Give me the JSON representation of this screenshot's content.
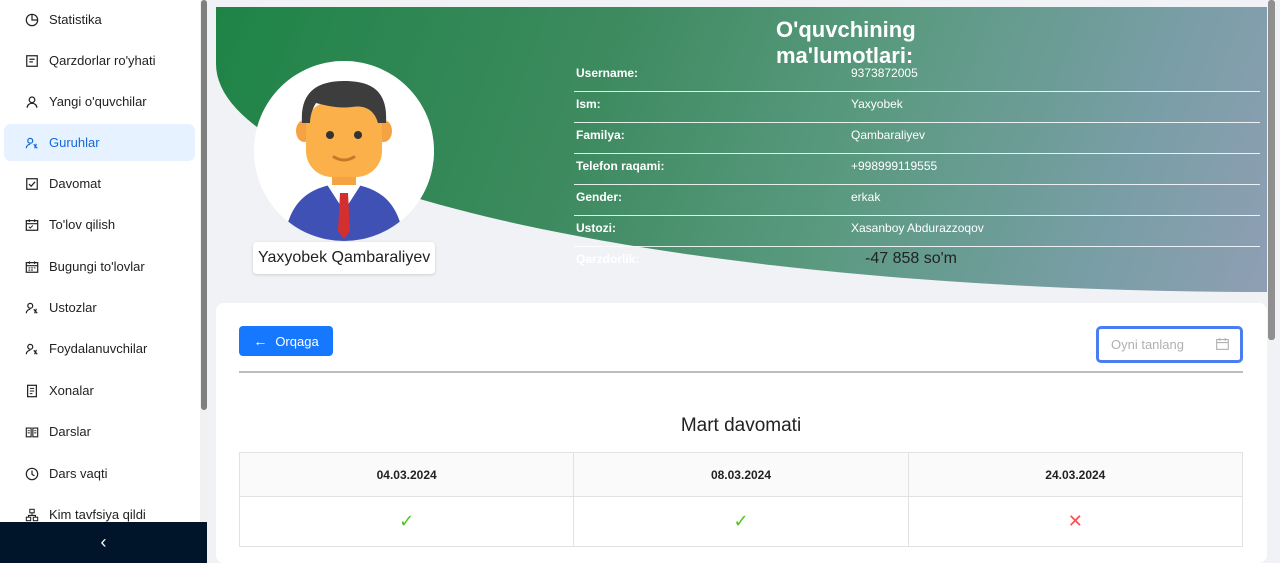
{
  "sidebar": {
    "items": [
      {
        "label": "Statistika",
        "icon": "pie-chart-icon"
      },
      {
        "label": "Qarzdorlar ro'yhati",
        "icon": "account-book-icon"
      },
      {
        "label": "Yangi o'quvchilar",
        "icon": "user-icon"
      },
      {
        "label": "Guruhlar",
        "icon": "team-icon",
        "active": true
      },
      {
        "label": "Davomat",
        "icon": "check-square-icon"
      },
      {
        "label": "To'lov qilish",
        "icon": "schedule-icon"
      },
      {
        "label": "Bugungi to'lovlar",
        "icon": "calendar-icon"
      },
      {
        "label": "Ustozlar",
        "icon": "team-icon"
      },
      {
        "label": "Foydalanuvchilar",
        "icon": "team-icon"
      },
      {
        "label": "Xonalar",
        "icon": "file-icon"
      },
      {
        "label": "Darslar",
        "icon": "read-icon"
      },
      {
        "label": "Dars vaqti",
        "icon": "clock-icon"
      },
      {
        "label": "Kim tavfsiya qildi",
        "icon": "cluster-icon"
      }
    ],
    "collapse_glyph": "‹"
  },
  "profile": {
    "title": "O'quvchining ma'lumotlari:",
    "name_tag": "Yaxyobek Qambaraliyev",
    "fields": [
      {
        "label": "Username:",
        "value": "9373872005"
      },
      {
        "label": "Ism:",
        "value": "Yaxyobek"
      },
      {
        "label": "Familya:",
        "value": "Qambaraliyev"
      },
      {
        "label": "Telefon raqami:",
        "value": "+998999119555"
      },
      {
        "label": "Gender:",
        "value": "erkak"
      },
      {
        "label": "Ustozi:",
        "value": "Xasanboy Abdurazzoqov"
      },
      {
        "label": "Qarzdorlik:",
        "value": "-47 858 so'm"
      }
    ]
  },
  "attendance": {
    "back_label": "Orqaga",
    "month_placeholder": "Oyni tanlang",
    "month_title": "Mart davomati",
    "dates": [
      "04.03.2024",
      "08.03.2024",
      "24.03.2024"
    ],
    "marks": [
      {
        "status": "present",
        "glyph": "✓"
      },
      {
        "status": "present",
        "glyph": "✓"
      },
      {
        "status": "absent",
        "glyph": "✕"
      }
    ]
  },
  "colors": {
    "accent": "#1677ff",
    "sidebar_footer": "#001529",
    "present": "#52c41a",
    "absent": "#ff4d4f"
  }
}
